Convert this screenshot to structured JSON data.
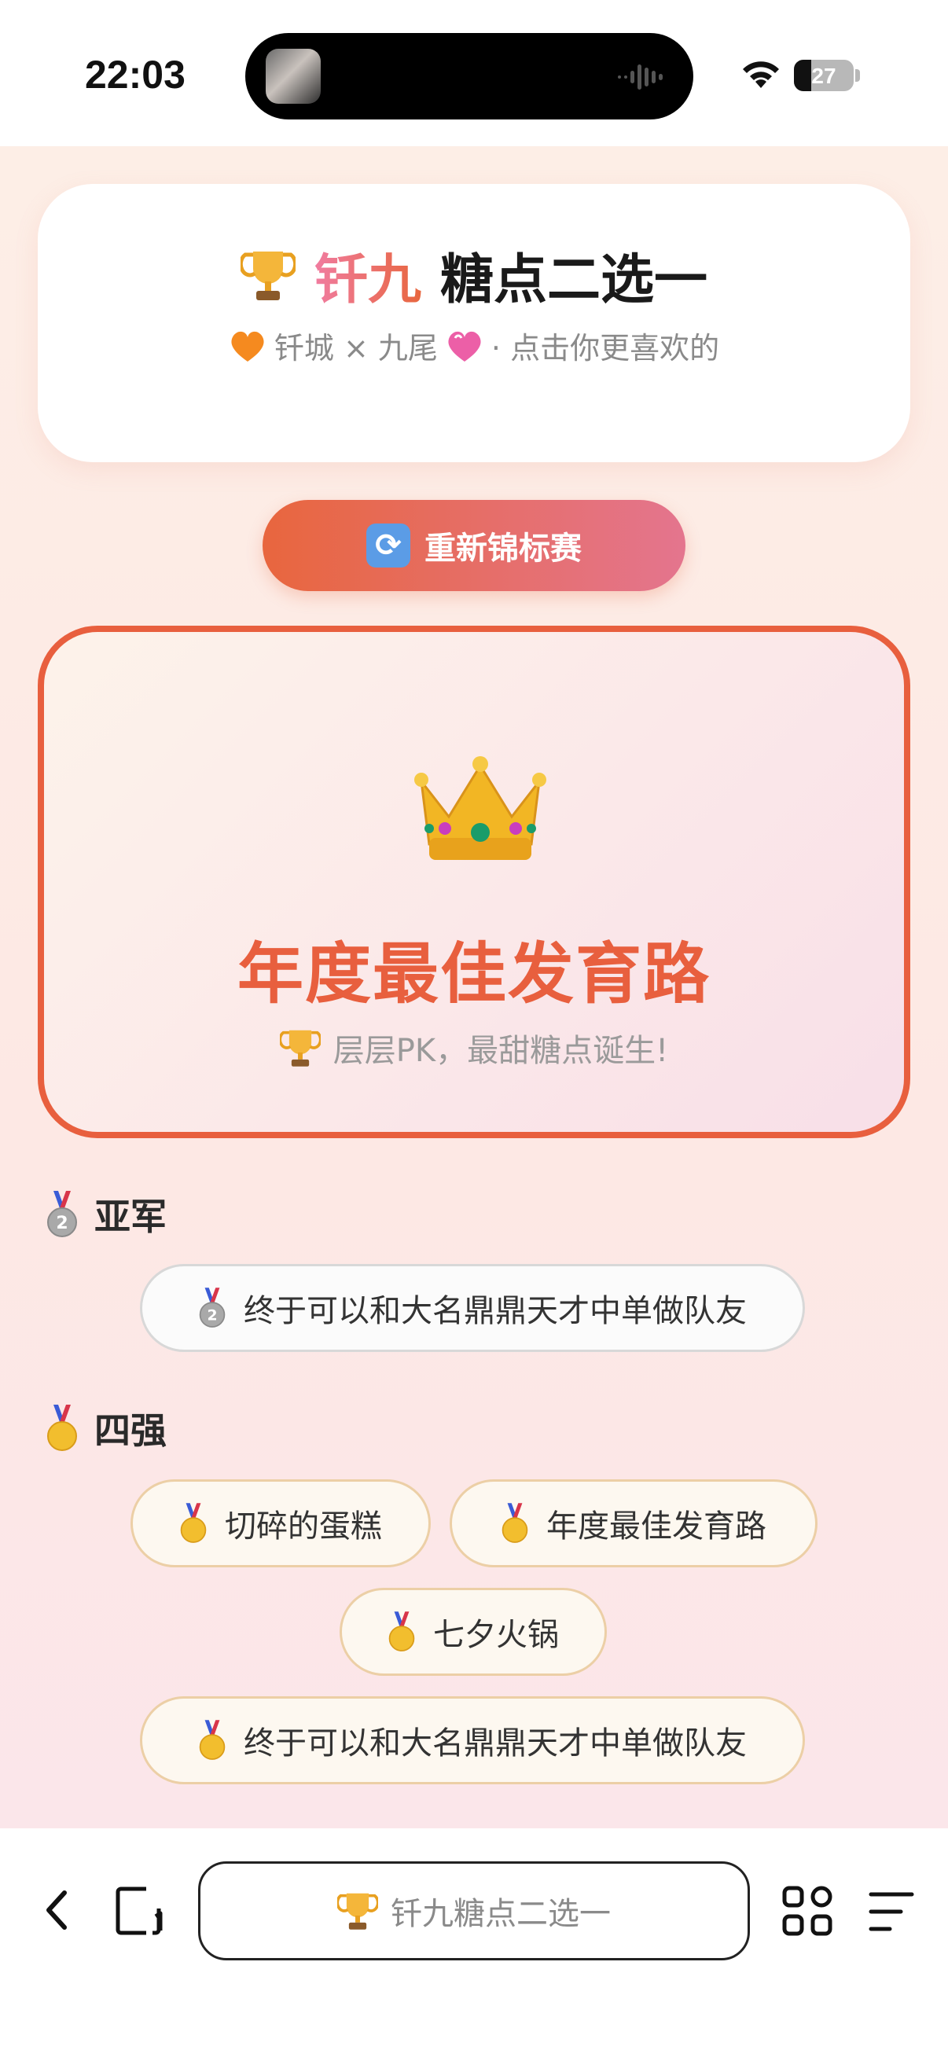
{
  "status_bar": {
    "time": "22:03",
    "battery": "27"
  },
  "header": {
    "title_icon": "trophy-icon",
    "title_accent": "钎九",
    "title_rest": "糖点二选一",
    "subtitle_left_icon": "orange-heart-icon",
    "subtitle_text": "钎城 × 九尾",
    "subtitle_right_icon": "pink-heart-icon",
    "subtitle_tail": "· 点击你更喜欢的"
  },
  "restart_button": {
    "icon": "refresh-icon",
    "label": "重新锦标赛"
  },
  "champion": {
    "icon": "crown-icon",
    "name": "年度最佳发育路",
    "subtitle": "层层PK，最甜糖点诞生!"
  },
  "runner_up": {
    "title": "亚军",
    "items": [
      "终于可以和大名鼎鼎天才中单做队友"
    ]
  },
  "top_four": {
    "title": "四强",
    "items": [
      "切碎的蛋糕",
      "年度最佳发育路",
      "七夕火锅",
      "终于可以和大名鼎鼎天才中单做队友"
    ]
  },
  "browser_bar": {
    "url_text": "钎九糖点二选一"
  },
  "colors": {
    "accent": "#e85f3e",
    "pink": "#e4758e",
    "background": "#fdeee6"
  }
}
